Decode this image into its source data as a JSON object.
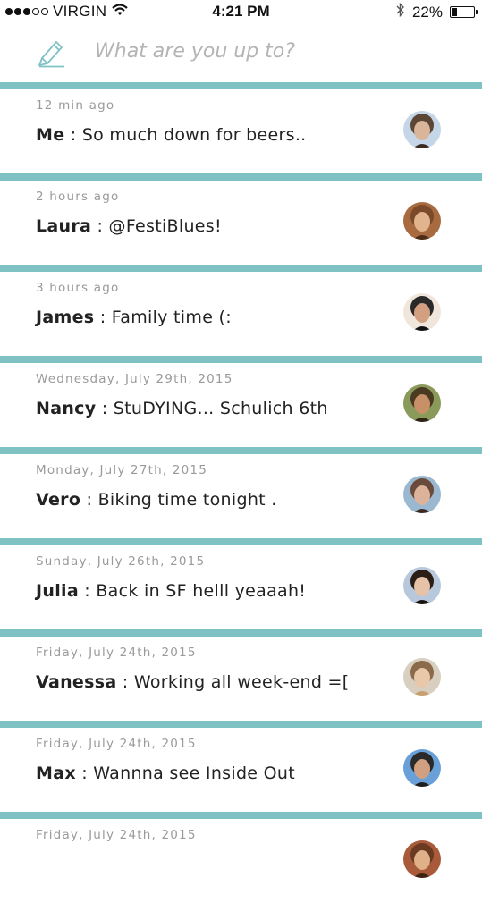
{
  "status_bar": {
    "carrier": "VIRGIN",
    "time": "4:21 PM",
    "battery": "22%",
    "signal_bars": 3
  },
  "composer": {
    "placeholder": "What are you up to?"
  },
  "posts": [
    {
      "time": "12 min ago",
      "name": "Me",
      "message": "So much down for beers..",
      "avatar_colors": [
        "#5c4636",
        "#d9b59a",
        "#3a2a20",
        "#c5d6e8"
      ]
    },
    {
      "time": "2 hours ago",
      "name": "Laura",
      "message": "@FestiBlues!",
      "avatar_colors": [
        "#7a4a2a",
        "#e2b48e",
        "#4b2c17",
        "#a86b3f"
      ]
    },
    {
      "time": "3 hours ago",
      "name": "James",
      "message": "Family time (:",
      "avatar_colors": [
        "#2a2a2a",
        "#d2a080",
        "#111111",
        "#f0e6dc"
      ]
    },
    {
      "time": "Wednesday, July 29th, 2015",
      "name": "Nancy",
      "message": "StuDYING... Schulich 6th",
      "avatar_colors": [
        "#4a3a22",
        "#c89066",
        "#2e2416",
        "#8a9a5a"
      ]
    },
    {
      "time": "Monday, July 27th, 2015",
      "name": "Vero",
      "message": "Biking time tonight .",
      "avatar_colors": [
        "#6a4a3a",
        "#dcb29a",
        "#3b2a22",
        "#9ab8d0"
      ]
    },
    {
      "time": "Sunday, July 26th, 2015",
      "name": "Julia",
      "message": "Back in SF helll yeaaah!",
      "avatar_colors": [
        "#2a1e16",
        "#e6c2a8",
        "#1a120c",
        "#b8c8dc"
      ]
    },
    {
      "time": "Friday, July 24th, 2015",
      "name": "Vanessa",
      "message": "Working all week-end =[",
      "avatar_colors": [
        "#8a6a4a",
        "#e8c8a8",
        "#c8a070",
        "#d8cfc0"
      ]
    },
    {
      "time": "Friday, July 24th, 2015",
      "name": "Max",
      "message": "Wannna see Inside Out",
      "avatar_colors": [
        "#2a2a2a",
        "#d0a080",
        "#1e1e1e",
        "#6aa0d8"
      ]
    },
    {
      "time": "Friday, July 24th, 2015",
      "name": "",
      "message": "",
      "avatar_colors": [
        "#6a3a22",
        "#e0b088",
        "#3e2214",
        "#a85a3a"
      ]
    }
  ],
  "theme": {
    "divider": "#7fc2c4",
    "placeholder": "#b4b4b4",
    "timestamp": "#9a9a9a",
    "pencil": "#7fc2c4"
  }
}
